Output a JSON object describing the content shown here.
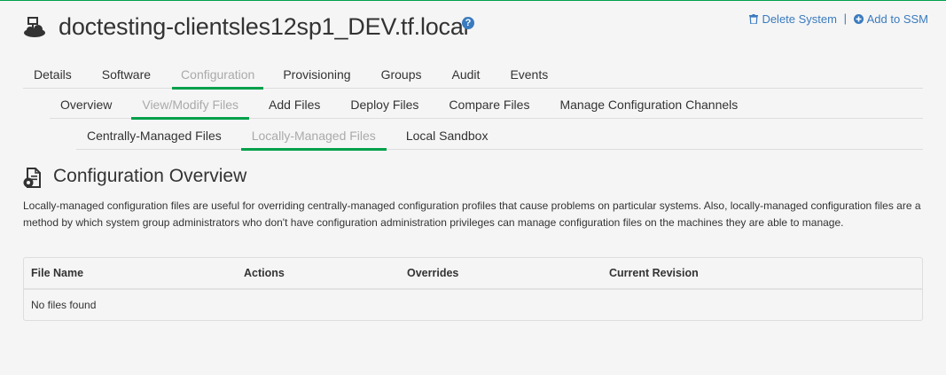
{
  "header": {
    "system_name": "doctesting-clientsles12sp1_DEV.tf.local",
    "system_icon": "system-cloud-icon",
    "help_icon": "help-icon",
    "actions": {
      "delete_label": "Delete System",
      "delete_icon": "trash-icon",
      "ssm_label": "Add to SSM",
      "ssm_icon": "plus-circle-icon",
      "separator": "|"
    }
  },
  "tabs_level1": [
    {
      "label": "Details",
      "active": false
    },
    {
      "label": "Software",
      "active": false
    },
    {
      "label": "Configuration",
      "active": true
    },
    {
      "label": "Provisioning",
      "active": false
    },
    {
      "label": "Groups",
      "active": false
    },
    {
      "label": "Audit",
      "active": false
    },
    {
      "label": "Events",
      "active": false
    }
  ],
  "tabs_level2": [
    {
      "label": "Overview",
      "active": false
    },
    {
      "label": "View/Modify Files",
      "active": true
    },
    {
      "label": "Add Files",
      "active": false
    },
    {
      "label": "Deploy Files",
      "active": false
    },
    {
      "label": "Compare Files",
      "active": false
    },
    {
      "label": "Manage Configuration Channels",
      "active": false
    }
  ],
  "tabs_level3": [
    {
      "label": "Centrally-Managed Files",
      "active": false
    },
    {
      "label": "Locally-Managed Files",
      "active": true
    },
    {
      "label": "Local Sandbox",
      "active": false
    }
  ],
  "section": {
    "title": "Configuration Overview",
    "icon": "config-file-gear-icon",
    "description": "Locally-managed configuration files are useful for overriding centrally-managed configuration profiles that cause problems on particular systems. Also, locally-managed configuration files are a method by which system group administrators who don't have configuration administration privileges can manage configuration files on the machines they are able to manage."
  },
  "table": {
    "columns": [
      "File Name",
      "Actions",
      "Overrides",
      "Current Revision"
    ],
    "empty_message": "No files found"
  },
  "colors": {
    "accent_green": "#00a04a",
    "link_blue": "#3a7bbf",
    "inactive_tab_gray": "#aaaaaa"
  }
}
